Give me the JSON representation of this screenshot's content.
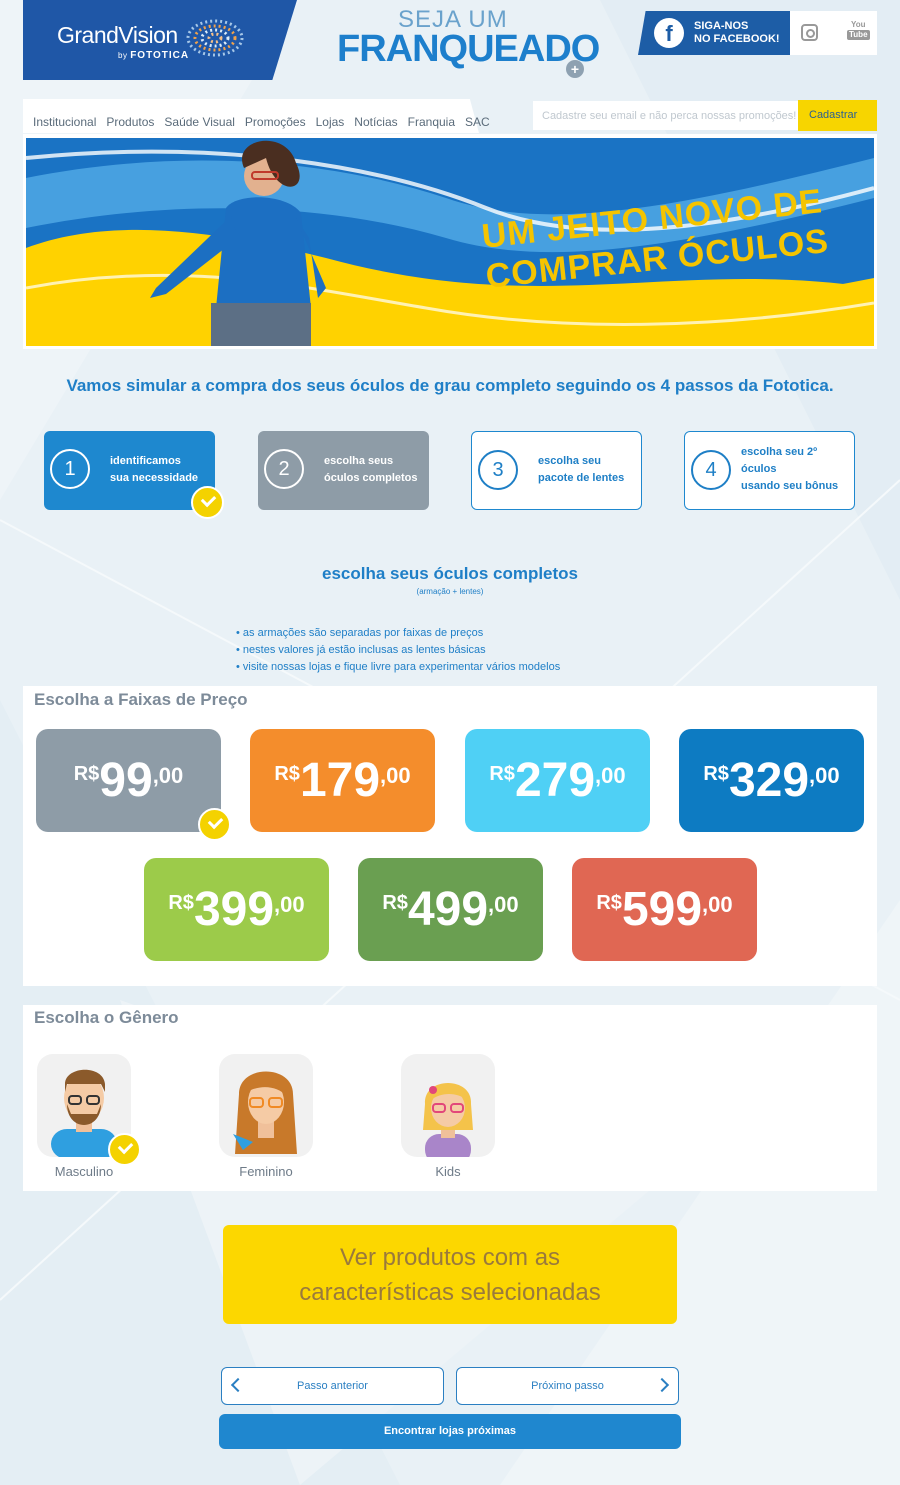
{
  "header": {
    "logo_main": "GrandVision",
    "logo_by": "by",
    "logo_brand": "FOTOTICA",
    "seja": "SEJA UM",
    "franqueado": "FRANQUEADO",
    "facebook_line1": "SIGA-NOS",
    "facebook_line2": "NO FACEBOOK!",
    "youtube_top": "You",
    "youtube_bottom": "Tube"
  },
  "nav": {
    "items": [
      "Institucional",
      "Produtos",
      "Saúde Visual",
      "Promoções",
      "Lojas",
      "Notícias",
      "Franquia",
      "SAC"
    ],
    "email_placeholder": "Cadastre seu email e não perca nossas promoções!",
    "signup_label": "Cadastrar"
  },
  "banner": {
    "line1": "UM JEITO NOVO DE",
    "line2": "COMPRAR ÓCULOS"
  },
  "intro": "Vamos simular a compra dos seus óculos de grau completo seguindo os 4 passos da Fototica.",
  "steps": [
    {
      "num": "1",
      "label_line1": "identificamos",
      "label_line2": "sua necessidade",
      "label_line3": ""
    },
    {
      "num": "2",
      "label_line1": "escolha seus",
      "label_line2": "óculos completos",
      "label_line3": ""
    },
    {
      "num": "3",
      "label_line1": "escolha seu",
      "label_line2": "pacote de lentes",
      "label_line3": ""
    },
    {
      "num": "4",
      "label_line1": "escolha seu 2º",
      "label_line2": "óculos",
      "label_line3": "usando seu bônus"
    }
  ],
  "section": {
    "title": "escolha seus óculos completos",
    "subtitle": "(armação + lentes)",
    "bullets": [
      "• as armações são separadas por faixas de preços",
      "• nestes valores já estão inclusas as lentes básicas",
      "• visite nossas lojas e fique livre para experimentar vários modelos"
    ]
  },
  "prices": {
    "title": "Escolha a Faixas de Preço",
    "currency": "R$",
    "items": [
      {
        "main": "99",
        "cents": ",00",
        "color": "#8e9ca7"
      },
      {
        "main": "179",
        "cents": ",00",
        "color": "#f48d2c"
      },
      {
        "main": "279",
        "cents": ",00",
        "color": "#4fd0f5"
      },
      {
        "main": "329",
        "cents": ",00",
        "color": "#0d7bc2"
      },
      {
        "main": "399",
        "cents": ",00",
        "color": "#9ccb4a"
      },
      {
        "main": "499",
        "cents": ",00",
        "color": "#6a9f51"
      },
      {
        "main": "599",
        "cents": ",00",
        "color": "#e06753"
      }
    ]
  },
  "gender": {
    "title": "Escolha o Gênero",
    "items": [
      "Masculino",
      "Feminino",
      "Kids"
    ]
  },
  "cta": {
    "line1": "Ver produtos com as",
    "line2": "características selecionadas"
  },
  "buttons": {
    "prev": "Passo anterior",
    "next": "Próximo passo",
    "find": "Encontrar lojas próximas"
  },
  "colors": {
    "brand_blue": "#1f57a7",
    "accent_yellow": "#f4d200",
    "step_active": "#1e88cf",
    "step_done": "#8e9ca7"
  }
}
